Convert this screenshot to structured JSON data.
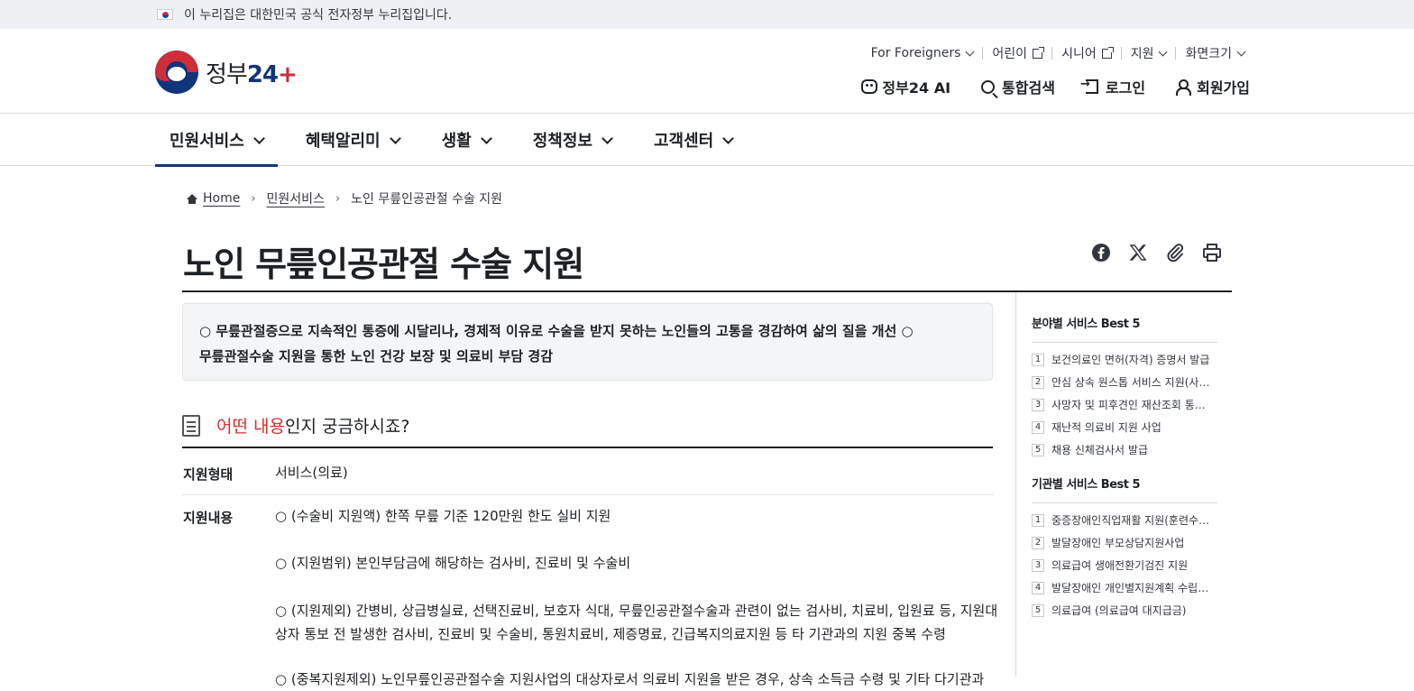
{
  "gov_banner": {
    "text": "이 누리집은 대한민국 공식 전자정부 누리집입니다."
  },
  "logo": {
    "text_ko": "정부",
    "text_num": "24",
    "text_plus": "+"
  },
  "util_links": {
    "foreigners": "For Foreigners",
    "kids": "어린이",
    "senior": "시니어",
    "support": "지원",
    "screen_size": "화면크기"
  },
  "main_links": {
    "ai": "정부24 AI",
    "search": "통합검색",
    "login": "로그인",
    "signup": "회원가입"
  },
  "gnb": [
    {
      "label": "민원서비스",
      "active": true
    },
    {
      "label": "혜택알리미"
    },
    {
      "label": "생활"
    },
    {
      "label": "정책정보"
    },
    {
      "label": "고객센터"
    }
  ],
  "breadcrumb": {
    "home": "Home",
    "level1": "민원서비스",
    "current": "노인 무릎인공관절 수술 지원"
  },
  "page_title": "노인 무릎인공관절 수술 지원",
  "summary": {
    "line1": "○ 무릎관절증으로 지속적인 통증에 시달리나, 경제적 이유로 수술을 받지 못하는 노인들의 고통을 경감하여 삶의 질을 개선 ○",
    "line2": "무릎관절수술 지원을 통한 노인 건강 보장 및 의료비 부담 경감"
  },
  "section": {
    "accent": "어떤 내용",
    "rest": "인지 궁금하시죠?"
  },
  "details": {
    "type_label": "지원형태",
    "type_value": "서비스(의료)",
    "content_label": "지원내용",
    "content_lines": [
      "○ (수술비 지원액) 한쪽 무릎 기준 120만원 한도 실비 지원",
      "○ (지원범위) 본인부담금에 해당하는 검사비, 진료비 및 수술비",
      "○ (지원제외)  간병비, 상급병실료, 선택진료비, 보호자 식대, 무릎인공관절수술과 관련이 없는 검사비, 치료비, 입원료 등, 지원대",
      "상자 통보 전 발생한 검사비, 진료비 및 수술비, 통원치료비, 제증명료,  긴급복지의료지원 등 타 기관과의 지원 중복 수령",
      "○ (중복지원제외) 노인무릎인공관절수술 지원사업의 대상자로서 의료비 지원을 받은 경우, 상속 소득금 수령 및 기타 다기관과"
    ]
  },
  "sidebar": {
    "field_title": "분야별 서비스 Best 5",
    "field_items": [
      {
        "num": "1",
        "text": "보건의료인 면허(자격) 증명서 발급"
      },
      {
        "num": "2",
        "text": "안심 상속 원스톱 서비스 지원(사…"
      },
      {
        "num": "3",
        "text": "사망자 및 피후견인 재산조회 통…"
      },
      {
        "num": "4",
        "text": "재난적 의료비 지원 사업"
      },
      {
        "num": "5",
        "text": "채용 신체검사서 발급"
      }
    ],
    "org_title": "기관별 서비스 Best 5",
    "org_items": [
      {
        "num": "1",
        "text": "중증장애인직업재활 지원(훈련수…"
      },
      {
        "num": "2",
        "text": "발달장애인 부모상담지원사업"
      },
      {
        "num": "3",
        "text": "의료급여 생애전환기검진 지원"
      },
      {
        "num": "4",
        "text": "발달장애인 개인별지원계획 수립…"
      },
      {
        "num": "5",
        "text": "의료급여 (의료급여 대지급금)"
      }
    ]
  }
}
